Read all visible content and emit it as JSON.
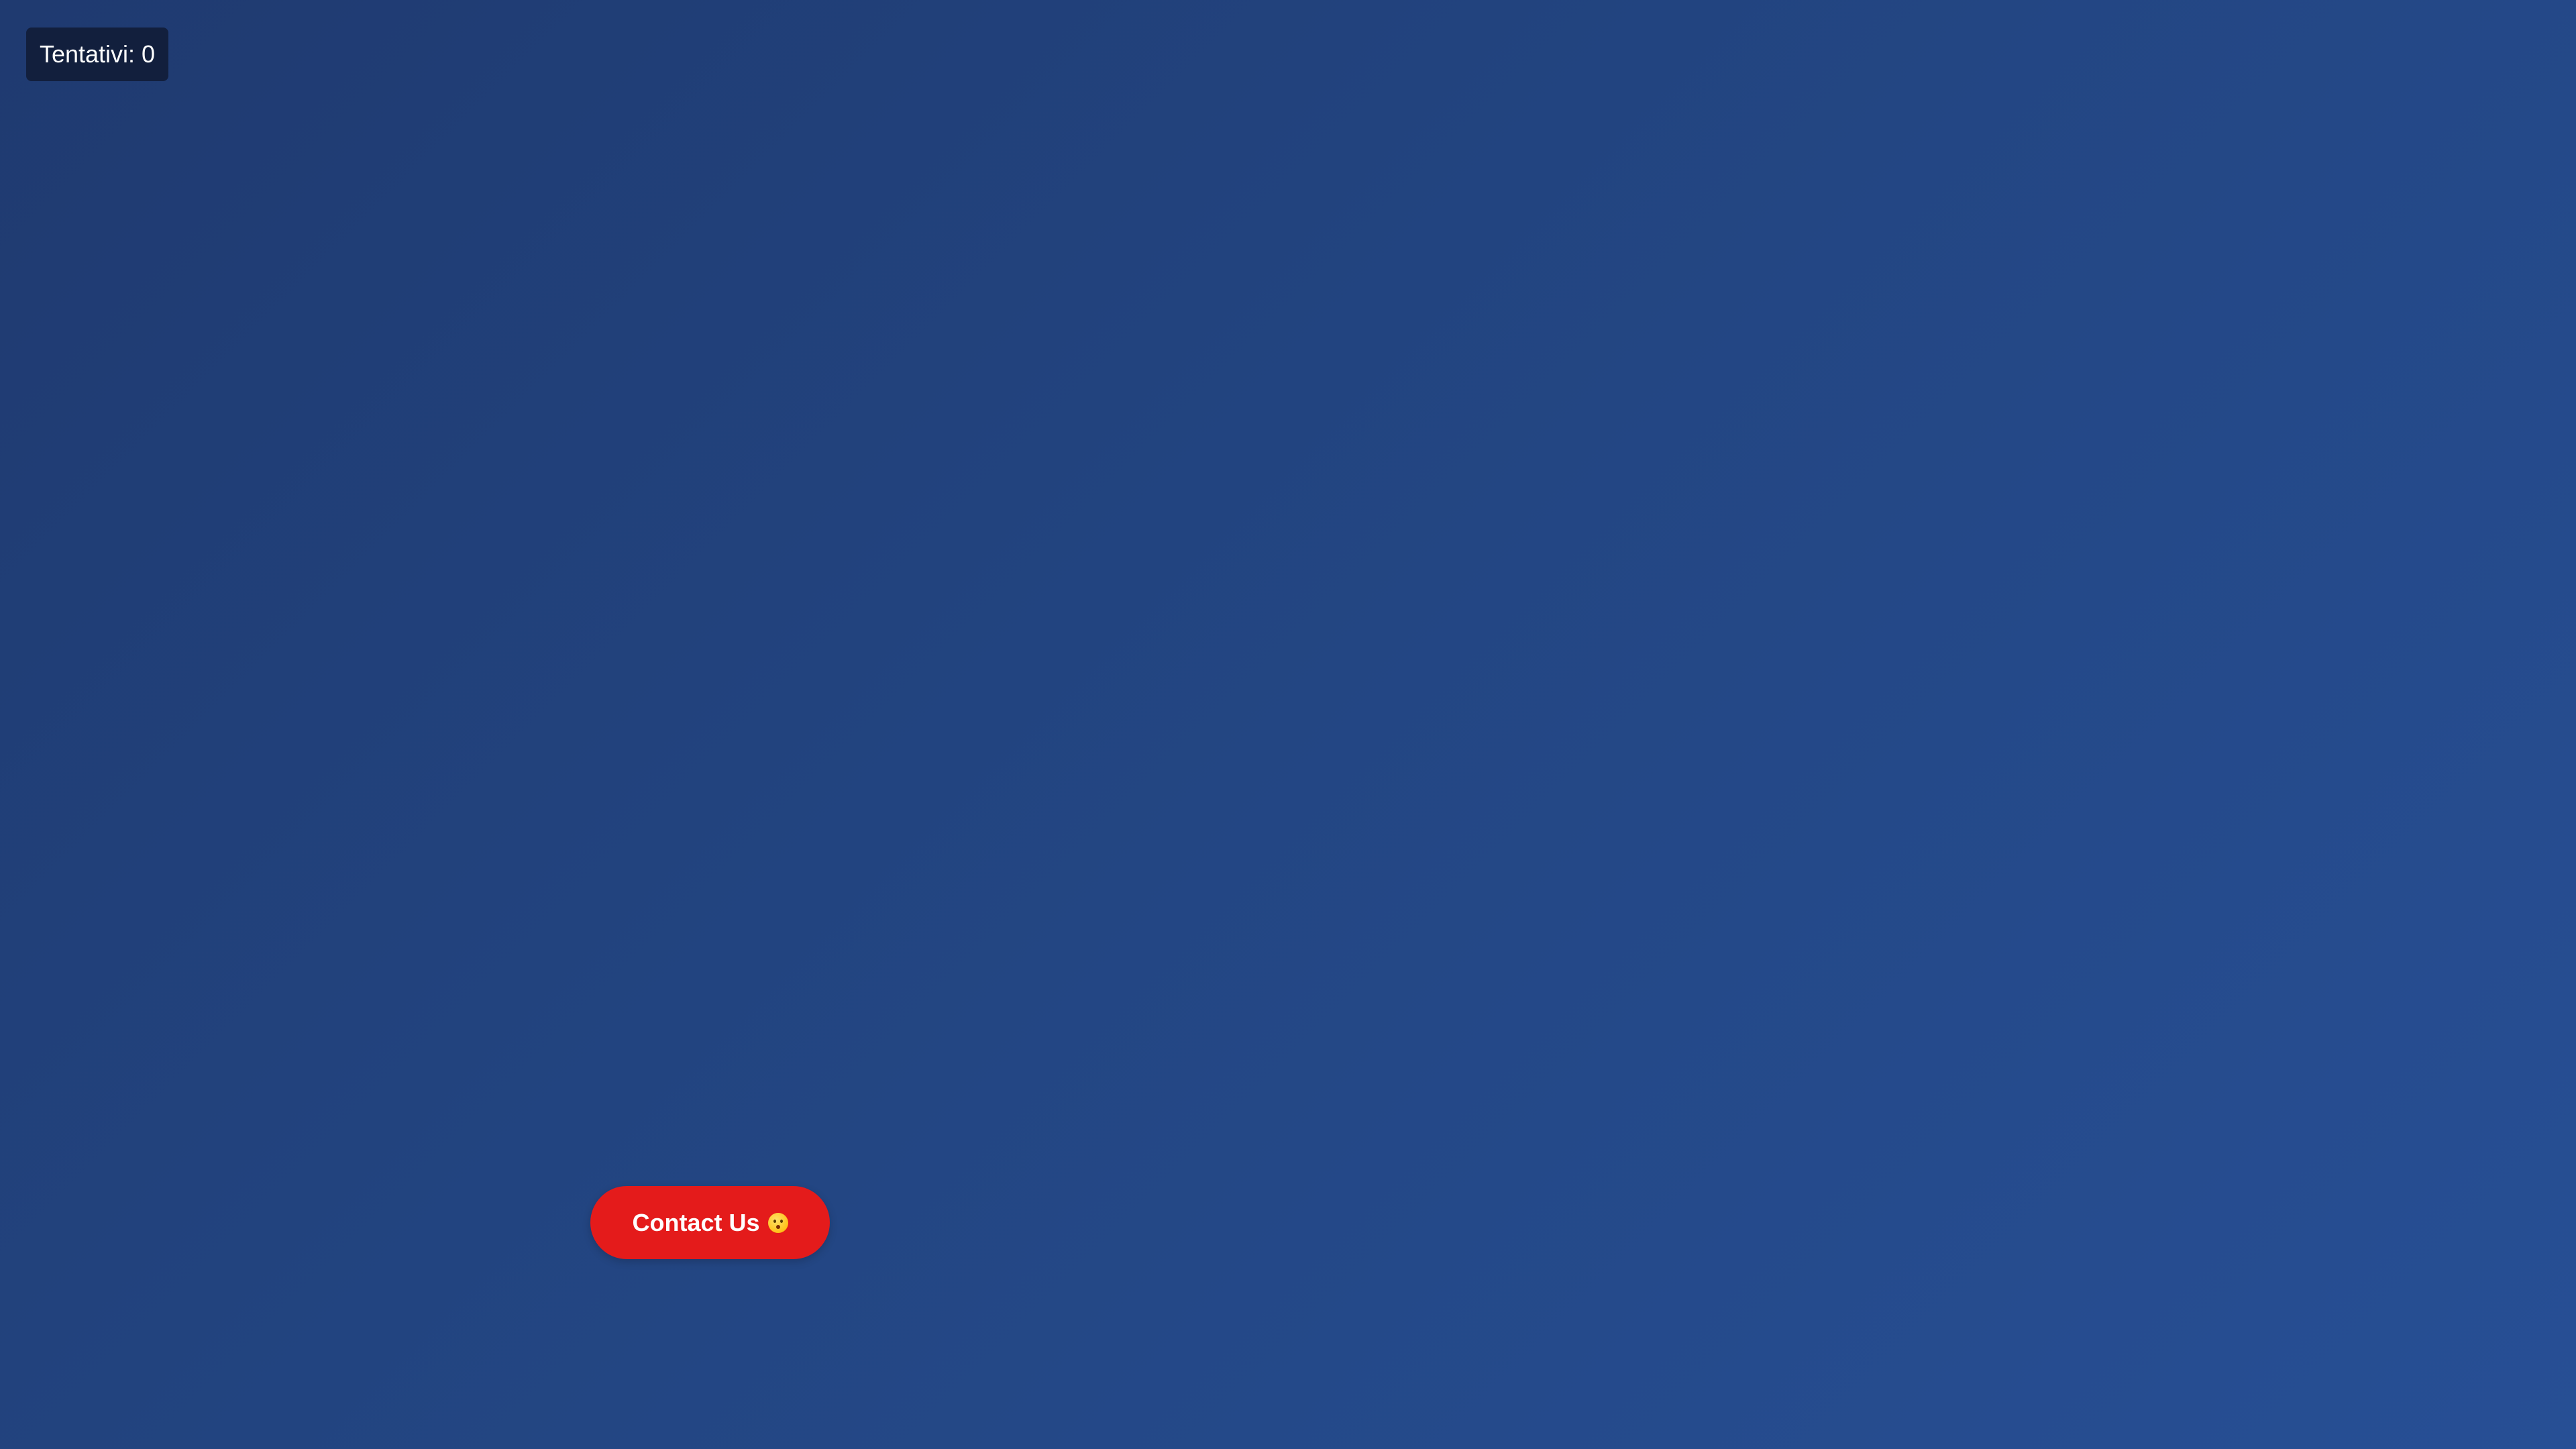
{
  "counter": {
    "text": "Tentativi: 0"
  },
  "contact_button": {
    "label": "Contact Us",
    "icon": "hushed-face-icon"
  },
  "colors": {
    "background_start": "#1f3a70",
    "background_end": "#274f95",
    "counter_bg": "#121f3d",
    "button_bg": "#e41b1b"
  }
}
